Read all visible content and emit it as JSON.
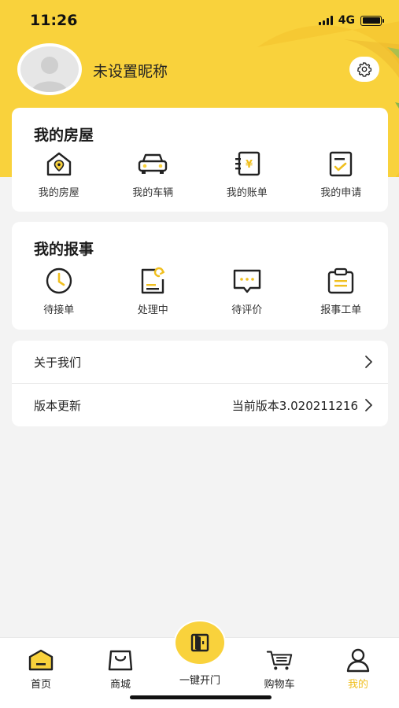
{
  "status_bar": {
    "time": "11:26",
    "network": "4G"
  },
  "profile": {
    "nickname": "未设置昵称"
  },
  "colors": {
    "accent": "#f9d23c",
    "active_tab": "#f0bf1e",
    "background": "#f3f3f3"
  },
  "my_house": {
    "title": "我的房屋",
    "items": [
      {
        "label": "我的房屋",
        "icon": "house-icon"
      },
      {
        "label": "我的车辆",
        "icon": "car-icon"
      },
      {
        "label": "我的账单",
        "icon": "bill-icon"
      },
      {
        "label": "我的申请",
        "icon": "application-icon"
      }
    ]
  },
  "my_reports": {
    "title": "我的报事",
    "items": [
      {
        "label": "待接单",
        "icon": "clock-icon"
      },
      {
        "label": "处理中",
        "icon": "processing-icon"
      },
      {
        "label": "待评价",
        "icon": "comment-icon"
      },
      {
        "label": "报事工单",
        "icon": "clipboard-icon"
      }
    ]
  },
  "menu": {
    "about": {
      "label": "关于我们"
    },
    "version": {
      "label": "版本更新",
      "value": "当前版本3.020211216"
    }
  },
  "tabbar": {
    "items": [
      {
        "label": "首页",
        "icon": "home-icon"
      },
      {
        "label": "商城",
        "icon": "shopping-bag-icon"
      },
      {
        "label": "一键开门",
        "icon": "door-icon"
      },
      {
        "label": "购物车",
        "icon": "cart-icon"
      },
      {
        "label": "我的",
        "icon": "user-icon",
        "active": true
      }
    ]
  }
}
